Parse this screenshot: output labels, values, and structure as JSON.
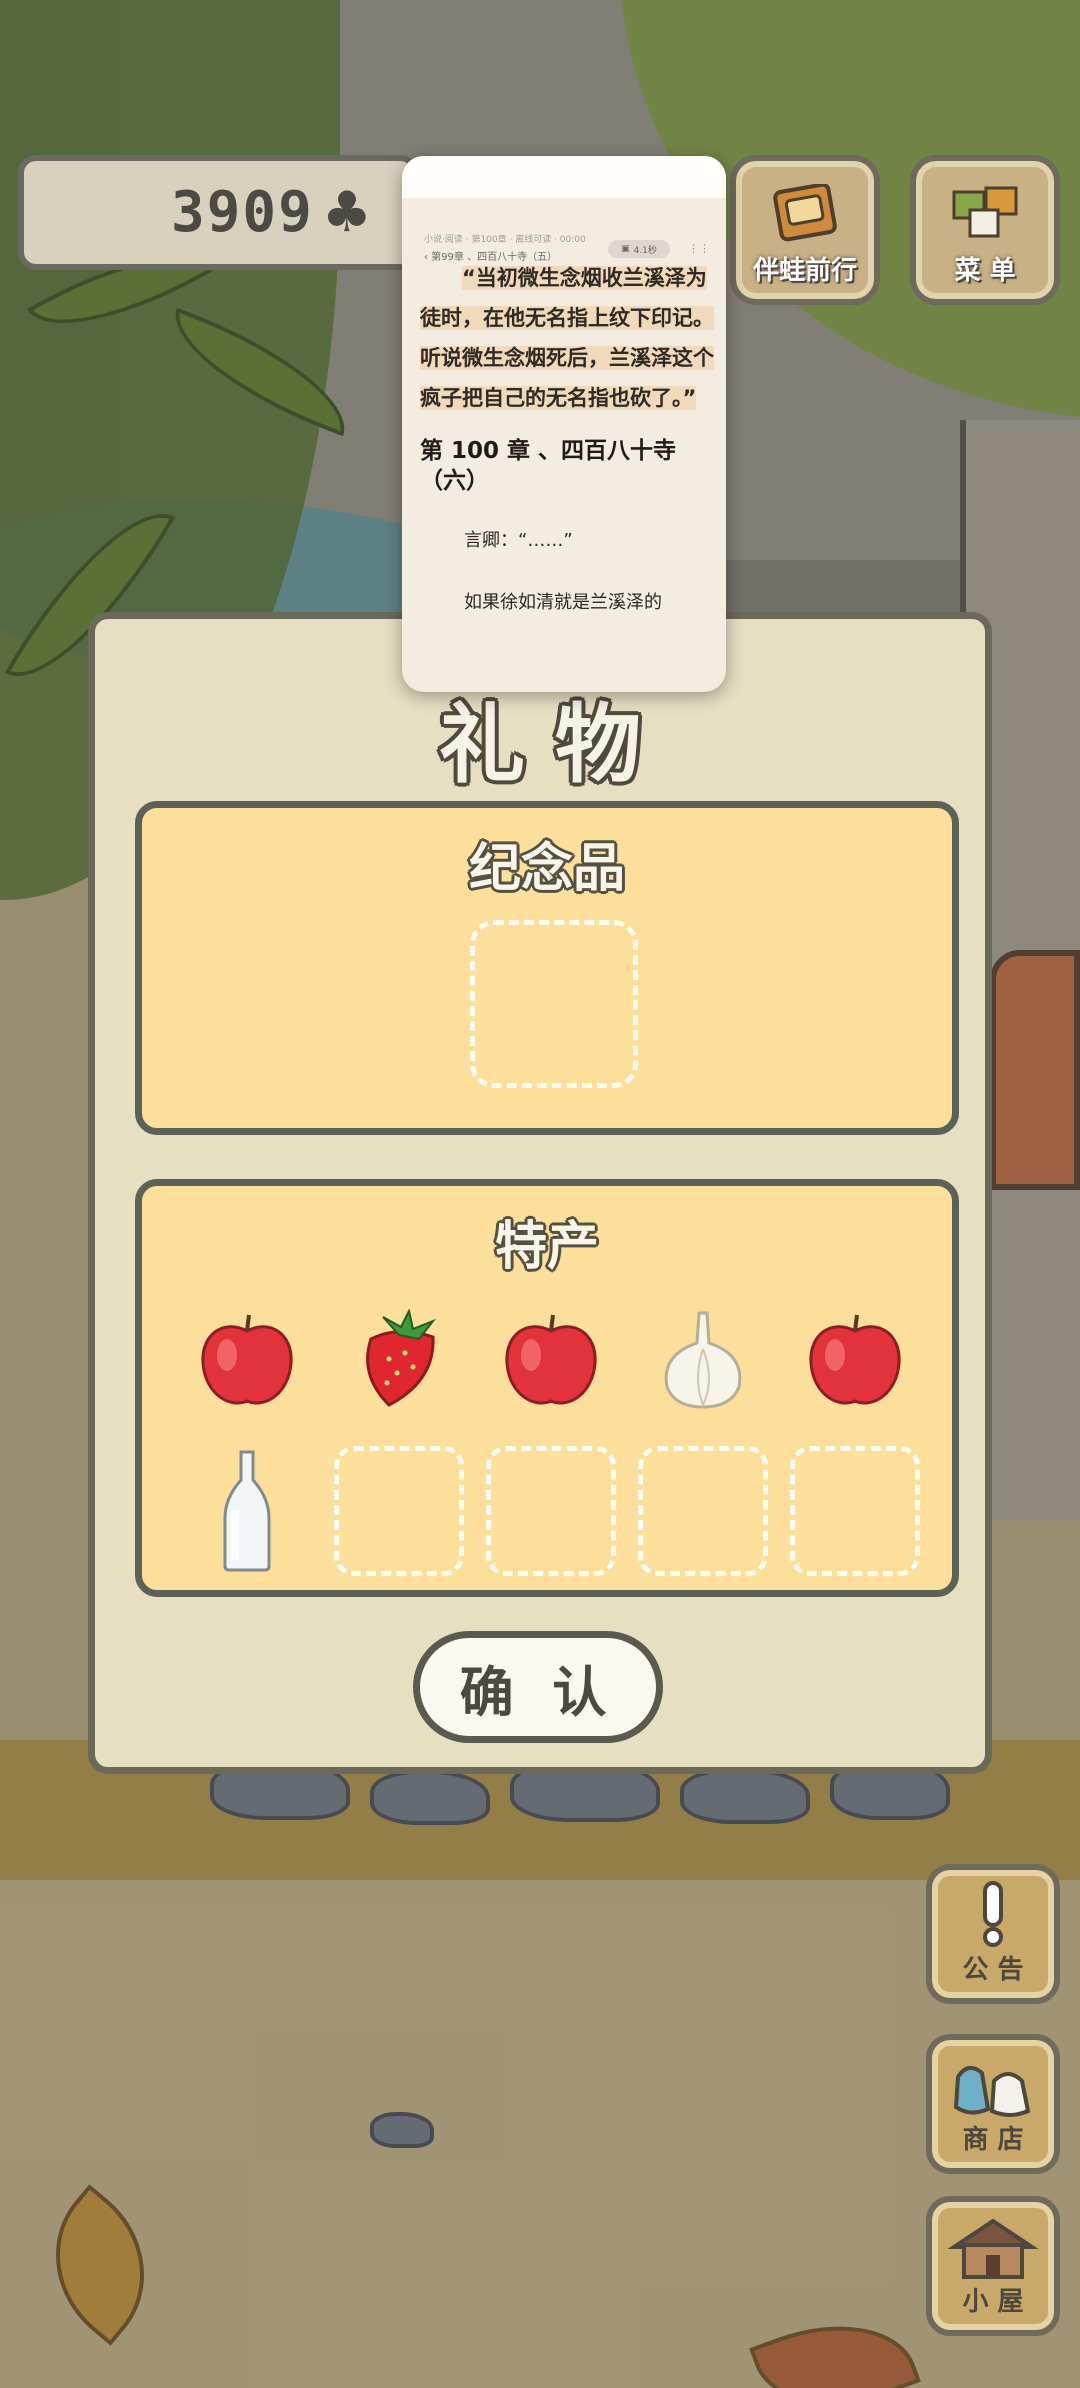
{
  "hud": {
    "clover_count": "3909",
    "clover_symbol": "♣",
    "travel_with_frog": "伴蛙前行",
    "menu": "菜 单"
  },
  "side_menu": {
    "announcement": "公 告",
    "shop": "商 店",
    "house": "小 屋"
  },
  "gift_dialog": {
    "title": "礼 物",
    "souvenir_section": {
      "title": "纪念品",
      "slots_filled": 0,
      "slots_total": 1
    },
    "specialty_section": {
      "title": "特产",
      "items": [
        "apple",
        "strawberry",
        "apple",
        "garlic",
        "apple",
        "glass-bottle"
      ],
      "empty_slots": 4
    },
    "confirm": "确 认"
  },
  "reader_window": {
    "tiny_header": "小说·阅读 · 第100章 · 离线可读 · 00:00",
    "chapter_nav": "‹ 第99章 、四百八十寺（五）",
    "pill": "4.1秒",
    "paragraph_1": "“当初微生念烟收兰溪泽为徒时，在他无名指上纹下印记。听说微生念烟死后，兰溪泽这个疯子把自己的无名指也砍了。”",
    "chapter_heading": "第 100 章 、四百八十寺（六）",
    "line_1": "言卿：“……”",
    "line_2": "如果徐如清就是兰溪泽的"
  },
  "colors": {
    "dialog_bg": "#e6dfc2",
    "panel_bg": "#fddf9c",
    "outline": "#5e6156",
    "highlight": "#f1d9bc"
  }
}
